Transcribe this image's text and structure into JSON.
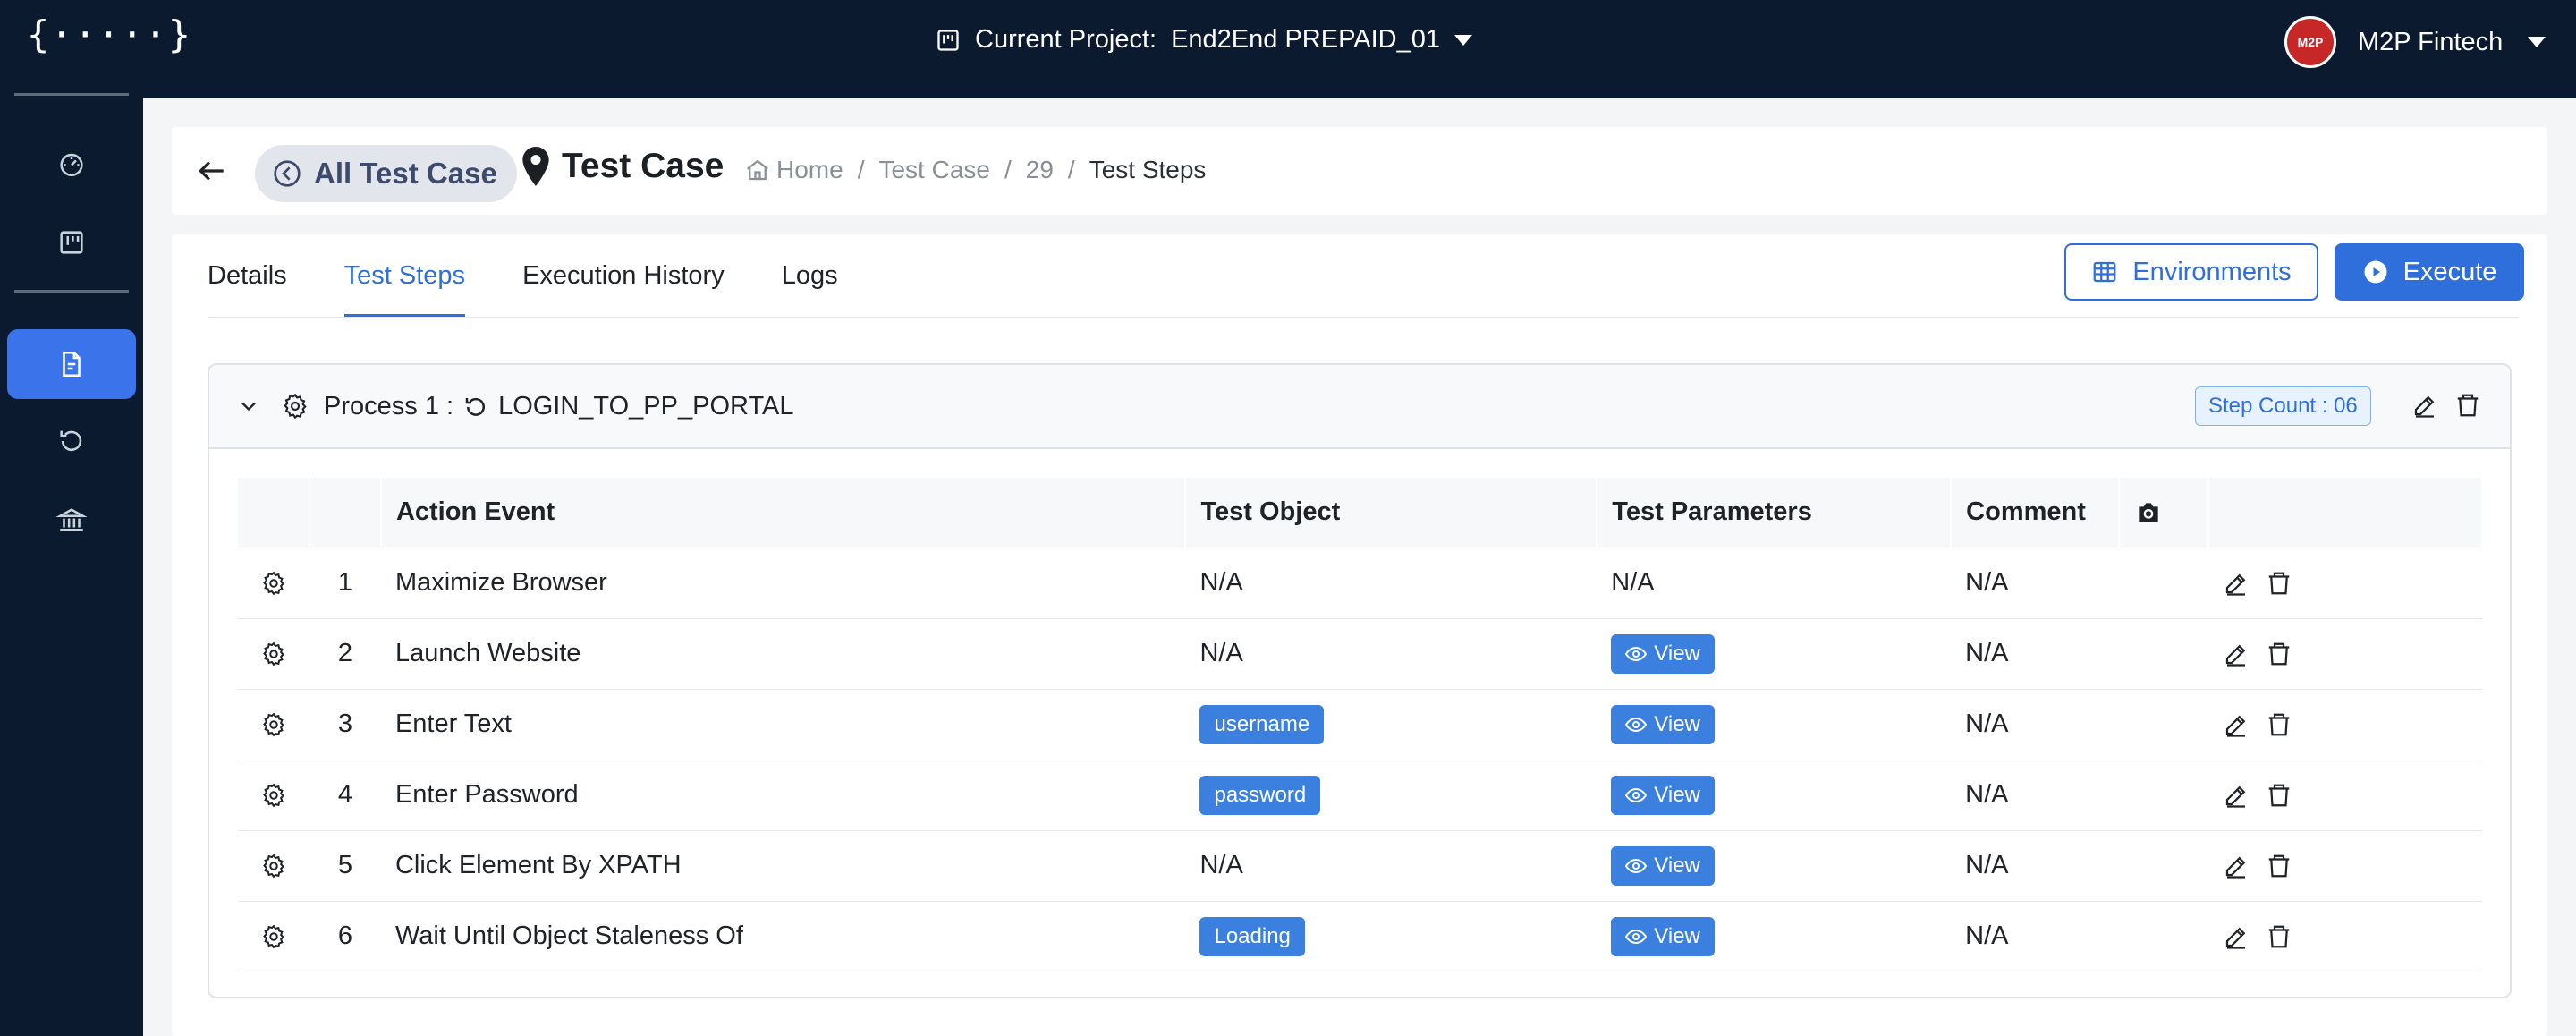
{
  "topbar": {
    "logo": "{·····}",
    "project_label": "Current Project:",
    "project_name": "End2End PREPAID_01",
    "avatar_text": "M2P",
    "user_name": "M2P Fintech"
  },
  "sidebar": {
    "items": [
      {
        "icon": "dashboard-icon"
      },
      {
        "icon": "kanban-icon"
      },
      {
        "icon": "file-icon",
        "active": true
      },
      {
        "icon": "history-icon"
      },
      {
        "icon": "bank-icon"
      }
    ]
  },
  "header": {
    "all_test_case": "All Test Case",
    "title": "Test Case",
    "breadcrumb": {
      "home": "Home",
      "sep": "/",
      "test_case": "Test Case",
      "id": "29",
      "current": "Test Steps"
    }
  },
  "tabs": [
    {
      "label": "Details",
      "active": false
    },
    {
      "label": "Test Steps",
      "active": true
    },
    {
      "label": "Execution History",
      "active": false
    },
    {
      "label": "Logs",
      "active": false
    }
  ],
  "actions": {
    "environments": "Environments",
    "execute": "Execute"
  },
  "process": {
    "label": "Process 1 :",
    "name": "LOGIN_TO_PP_PORTAL",
    "step_count": "Step Count : 06"
  },
  "table": {
    "headers": {
      "action_event": "Action Event",
      "test_object": "Test Object",
      "test_parameters": "Test Parameters",
      "comment": "Comment"
    },
    "rows": [
      {
        "num": "1",
        "action": "Maximize Browser",
        "object": "N/A",
        "object_tag": false,
        "params": "N/A",
        "params_view": false,
        "comment": "N/A"
      },
      {
        "num": "2",
        "action": "Launch Website",
        "object": "N/A",
        "object_tag": false,
        "params": "View",
        "params_view": true,
        "comment": "N/A"
      },
      {
        "num": "3",
        "action": "Enter Text",
        "object": "username",
        "object_tag": true,
        "params": "View",
        "params_view": true,
        "comment": "N/A"
      },
      {
        "num": "4",
        "action": "Enter Password",
        "object": "password",
        "object_tag": true,
        "params": "View",
        "params_view": true,
        "comment": "N/A"
      },
      {
        "num": "5",
        "action": "Click Element By XPATH",
        "object": "N/A",
        "object_tag": false,
        "params": "View",
        "params_view": true,
        "comment": "N/A"
      },
      {
        "num": "6",
        "action": "Wait Until Object Staleness Of",
        "object": "Loading",
        "object_tag": true,
        "params": "View",
        "params_view": true,
        "comment": "N/A"
      }
    ]
  },
  "colors": {
    "nav_bg": "#0b1a2e",
    "accent": "#2f6fdc",
    "tag_bg": "#3b80de",
    "avatar_bg": "#c62828"
  }
}
